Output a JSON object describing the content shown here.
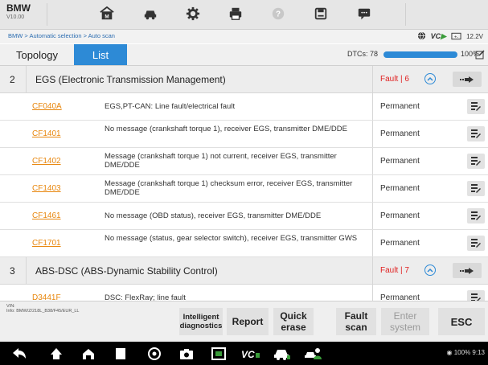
{
  "app": {
    "name": "BMW",
    "version": "V10.00"
  },
  "toolbar": {
    "icons": [
      "home-icon",
      "vehicle-icon",
      "settings-icon",
      "print-icon",
      "help-icon",
      "save-icon",
      "chat-icon"
    ]
  },
  "breadcrumb": {
    "path": "BMW > Automatic selection > Auto scan"
  },
  "status": {
    "vci_label": "VC",
    "voltage": "12.2V"
  },
  "tabs": {
    "topology": "Topology",
    "list": "List"
  },
  "scan": {
    "dtcs_label": "DTCs: 78",
    "progress_percent": 100,
    "progress_label": "100%"
  },
  "groups": [
    {
      "num": "2",
      "name": "EGS (Electronic Transmission Management)",
      "fault": "Fault | 6",
      "rows": [
        {
          "code": "CF040A",
          "desc": "EGS,PT-CAN: Line fault/electrical fault",
          "status": "Permanent"
        },
        {
          "code": "CF1401",
          "desc": "No message (crankshaft torque 1), receiver EGS, transmitter DME/DDE",
          "status": "Permanent"
        },
        {
          "code": "CF1402",
          "desc": "Message (crankshaft torque 1) not current, receiver EGS, transmitter DME/DDE",
          "status": "Permanent"
        },
        {
          "code": "CF1403",
          "desc": "Message (crankshaft torque 1) checksum error, receiver EGS, transmitter DME/DDE",
          "status": "Permanent"
        },
        {
          "code": "CF1461",
          "desc": "No message (OBD status), receiver EGS, transmitter DME/DDE",
          "status": "Permanent"
        },
        {
          "code": "CF1701",
          "desc": "No message (status, gear selector switch), receiver EGS, transmitter GWS",
          "status": "Permanent"
        }
      ]
    },
    {
      "num": "3",
      "name": "ABS-DSC (ABS-Dynamic Stability Control)",
      "fault": "Fault | 7",
      "rows": [
        {
          "code": "D3441F",
          "desc": "DSC: FlexRay; line fault",
          "status": "Permanent"
        }
      ]
    }
  ],
  "footer": {
    "vin_label": "VIN:",
    "info": "Info: BMW/Z/218L_B38/F45/EUR_LL",
    "buttons": {
      "intelligent_1": "Intelligent",
      "intelligent_2": "diagnostics",
      "report": "Report",
      "quick_1": "Quick",
      "quick_2": "erase",
      "fault_1": "Fault",
      "fault_2": "scan",
      "enter_1": "Enter",
      "enter_2": "system",
      "esc": "ESC"
    }
  },
  "navbar": {
    "status": "100% 9:13",
    "icons": [
      "back-icon",
      "home-icon",
      "house-icon",
      "recents-icon",
      "chrome-icon",
      "camera-icon",
      "screenshot-icon",
      "vcb-icon",
      "car-icon",
      "car-user-icon"
    ]
  },
  "colors": {
    "accent": "#2d8ad6",
    "fault": "#e02020",
    "code": "#e8870e"
  }
}
